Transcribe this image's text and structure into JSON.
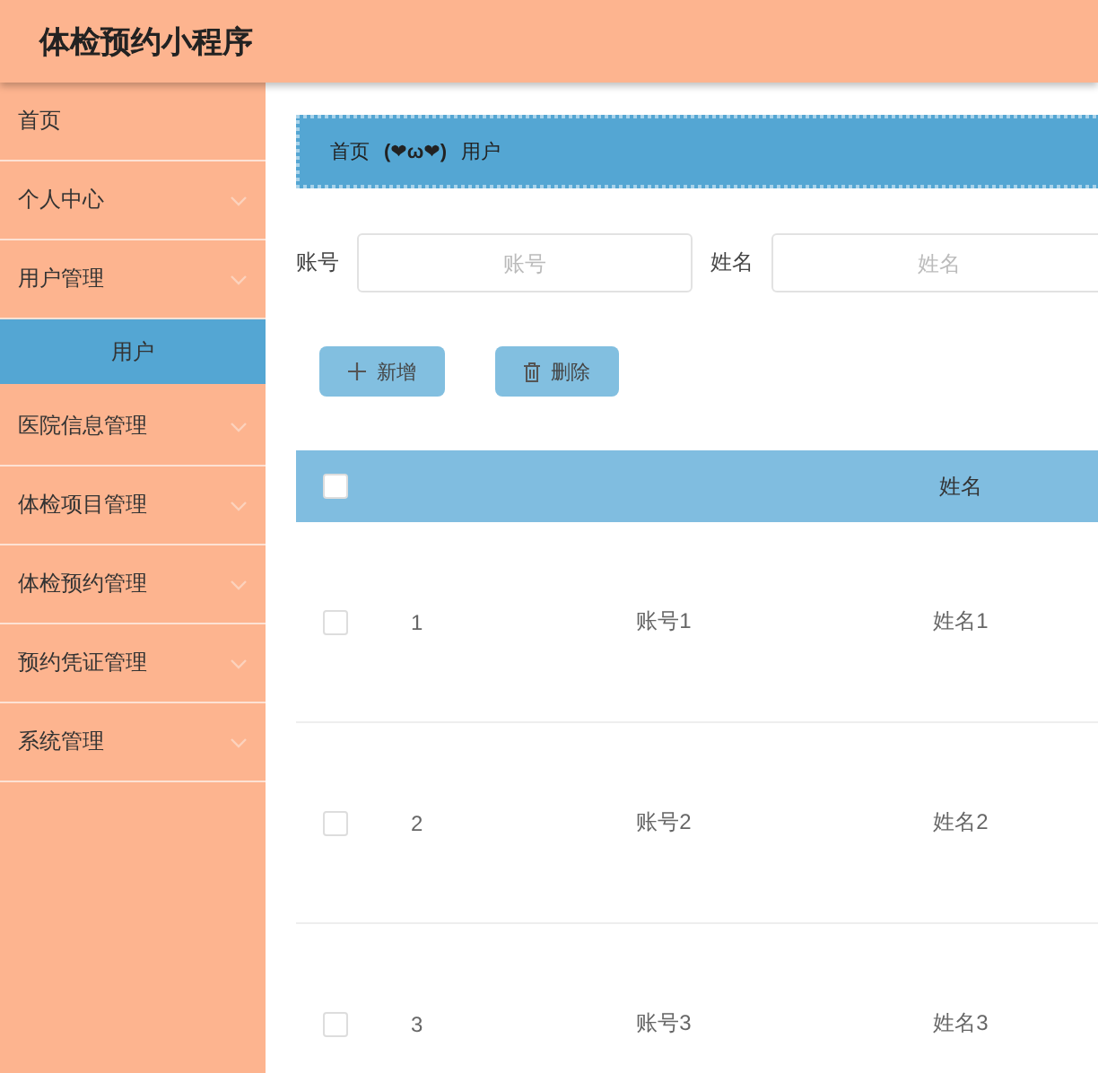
{
  "app": {
    "title": "体检预约小程序"
  },
  "sidebar": {
    "items": [
      {
        "label": "首页",
        "kind": "link",
        "selected": false
      },
      {
        "label": "个人中心",
        "kind": "menu",
        "selected": false
      },
      {
        "label": "用户管理",
        "kind": "menu",
        "selected": false,
        "children": [
          {
            "label": "用户",
            "kind": "sub",
            "selected": true
          }
        ]
      },
      {
        "label": "医院信息管理",
        "kind": "menu",
        "selected": false
      },
      {
        "label": "体检项目管理",
        "kind": "menu",
        "selected": false
      },
      {
        "label": "体检预约管理",
        "kind": "menu",
        "selected": false
      },
      {
        "label": "预约凭证管理",
        "kind": "menu",
        "selected": false
      },
      {
        "label": "系统管理",
        "kind": "menu",
        "selected": false
      }
    ]
  },
  "breadcrumb": {
    "items": [
      "首页",
      "用户"
    ],
    "separator": "(❤ω❤)"
  },
  "search": {
    "fields": [
      {
        "label": "账号",
        "placeholder": "账号"
      },
      {
        "label": "姓名",
        "placeholder": "姓名"
      }
    ]
  },
  "actions": [
    {
      "label": "新增",
      "kind": "add"
    },
    {
      "label": "删除",
      "kind": "delete"
    }
  ],
  "table": {
    "select_all": {
      "checked": false
    },
    "columns": [
      {},
      {},
      {
        "label": "姓名"
      }
    ],
    "rows": [
      {
        "checked": false,
        "cells": [
          "1",
          "账号1",
          "姓名1"
        ]
      },
      {
        "checked": false,
        "cells": [
          "2",
          "账号2",
          "姓名2"
        ]
      },
      {
        "checked": false,
        "cells": [
          "3",
          "账号3",
          "姓名3"
        ]
      }
    ]
  }
}
